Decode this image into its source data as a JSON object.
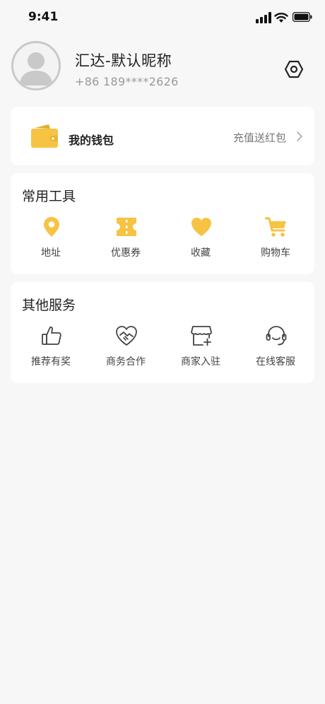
{
  "status_bar": {
    "time": "9:41"
  },
  "profile": {
    "nickname": "汇达-默认昵称",
    "phone": "+86 189****2626"
  },
  "wallet": {
    "label": "我的钱包",
    "promo": "充值送红包"
  },
  "tools": {
    "title": "常用工具",
    "items": [
      {
        "label": "地址",
        "icon": "location-pin-icon"
      },
      {
        "label": "优惠券",
        "icon": "coupon-icon"
      },
      {
        "label": "收藏",
        "icon": "heart-icon"
      },
      {
        "label": "购物车",
        "icon": "cart-icon"
      }
    ]
  },
  "services": {
    "title": "其他服务",
    "items": [
      {
        "label": "推荐有奖",
        "icon": "thumbs-up-icon"
      },
      {
        "label": "商务合作",
        "icon": "handshake-heart-icon"
      },
      {
        "label": "商家入驻",
        "icon": "store-add-icon"
      },
      {
        "label": "在线客服",
        "icon": "headset-icon"
      }
    ]
  },
  "colors": {
    "accent": "#f6c343",
    "background": "#f7f7f7",
    "card": "#ffffff",
    "outline_icon": "#444444"
  }
}
